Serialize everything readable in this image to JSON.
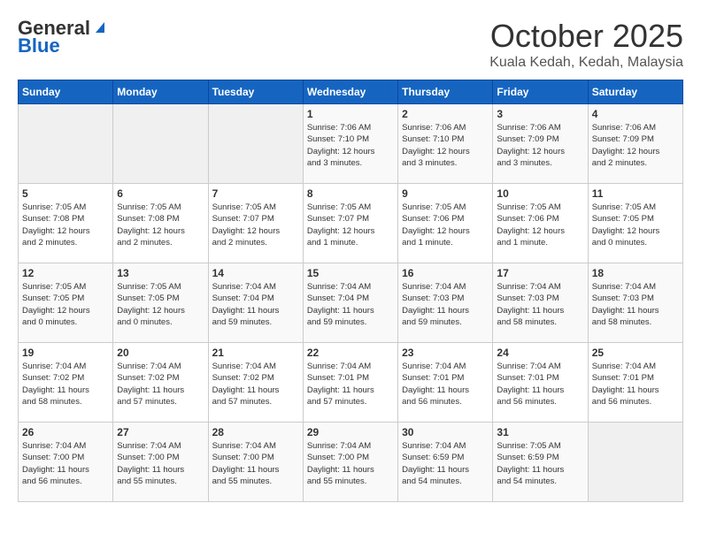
{
  "header": {
    "logo_general": "General",
    "logo_blue": "Blue",
    "month_title": "October 2025",
    "location": "Kuala Kedah, Kedah, Malaysia"
  },
  "days_of_week": [
    "Sunday",
    "Monday",
    "Tuesday",
    "Wednesday",
    "Thursday",
    "Friday",
    "Saturday"
  ],
  "weeks": [
    [
      {
        "num": "",
        "info": ""
      },
      {
        "num": "",
        "info": ""
      },
      {
        "num": "",
        "info": ""
      },
      {
        "num": "1",
        "info": "Sunrise: 7:06 AM\nSunset: 7:10 PM\nDaylight: 12 hours\nand 3 minutes."
      },
      {
        "num": "2",
        "info": "Sunrise: 7:06 AM\nSunset: 7:10 PM\nDaylight: 12 hours\nand 3 minutes."
      },
      {
        "num": "3",
        "info": "Sunrise: 7:06 AM\nSunset: 7:09 PM\nDaylight: 12 hours\nand 3 minutes."
      },
      {
        "num": "4",
        "info": "Sunrise: 7:06 AM\nSunset: 7:09 PM\nDaylight: 12 hours\nand 2 minutes."
      }
    ],
    [
      {
        "num": "5",
        "info": "Sunrise: 7:05 AM\nSunset: 7:08 PM\nDaylight: 12 hours\nand 2 minutes."
      },
      {
        "num": "6",
        "info": "Sunrise: 7:05 AM\nSunset: 7:08 PM\nDaylight: 12 hours\nand 2 minutes."
      },
      {
        "num": "7",
        "info": "Sunrise: 7:05 AM\nSunset: 7:07 PM\nDaylight: 12 hours\nand 2 minutes."
      },
      {
        "num": "8",
        "info": "Sunrise: 7:05 AM\nSunset: 7:07 PM\nDaylight: 12 hours\nand 1 minute."
      },
      {
        "num": "9",
        "info": "Sunrise: 7:05 AM\nSunset: 7:06 PM\nDaylight: 12 hours\nand 1 minute."
      },
      {
        "num": "10",
        "info": "Sunrise: 7:05 AM\nSunset: 7:06 PM\nDaylight: 12 hours\nand 1 minute."
      },
      {
        "num": "11",
        "info": "Sunrise: 7:05 AM\nSunset: 7:05 PM\nDaylight: 12 hours\nand 0 minutes."
      }
    ],
    [
      {
        "num": "12",
        "info": "Sunrise: 7:05 AM\nSunset: 7:05 PM\nDaylight: 12 hours\nand 0 minutes."
      },
      {
        "num": "13",
        "info": "Sunrise: 7:05 AM\nSunset: 7:05 PM\nDaylight: 12 hours\nand 0 minutes."
      },
      {
        "num": "14",
        "info": "Sunrise: 7:04 AM\nSunset: 7:04 PM\nDaylight: 11 hours\nand 59 minutes."
      },
      {
        "num": "15",
        "info": "Sunrise: 7:04 AM\nSunset: 7:04 PM\nDaylight: 11 hours\nand 59 minutes."
      },
      {
        "num": "16",
        "info": "Sunrise: 7:04 AM\nSunset: 7:03 PM\nDaylight: 11 hours\nand 59 minutes."
      },
      {
        "num": "17",
        "info": "Sunrise: 7:04 AM\nSunset: 7:03 PM\nDaylight: 11 hours\nand 58 minutes."
      },
      {
        "num": "18",
        "info": "Sunrise: 7:04 AM\nSunset: 7:03 PM\nDaylight: 11 hours\nand 58 minutes."
      }
    ],
    [
      {
        "num": "19",
        "info": "Sunrise: 7:04 AM\nSunset: 7:02 PM\nDaylight: 11 hours\nand 58 minutes."
      },
      {
        "num": "20",
        "info": "Sunrise: 7:04 AM\nSunset: 7:02 PM\nDaylight: 11 hours\nand 57 minutes."
      },
      {
        "num": "21",
        "info": "Sunrise: 7:04 AM\nSunset: 7:02 PM\nDaylight: 11 hours\nand 57 minutes."
      },
      {
        "num": "22",
        "info": "Sunrise: 7:04 AM\nSunset: 7:01 PM\nDaylight: 11 hours\nand 57 minutes."
      },
      {
        "num": "23",
        "info": "Sunrise: 7:04 AM\nSunset: 7:01 PM\nDaylight: 11 hours\nand 56 minutes."
      },
      {
        "num": "24",
        "info": "Sunrise: 7:04 AM\nSunset: 7:01 PM\nDaylight: 11 hours\nand 56 minutes."
      },
      {
        "num": "25",
        "info": "Sunrise: 7:04 AM\nSunset: 7:01 PM\nDaylight: 11 hours\nand 56 minutes."
      }
    ],
    [
      {
        "num": "26",
        "info": "Sunrise: 7:04 AM\nSunset: 7:00 PM\nDaylight: 11 hours\nand 56 minutes."
      },
      {
        "num": "27",
        "info": "Sunrise: 7:04 AM\nSunset: 7:00 PM\nDaylight: 11 hours\nand 55 minutes."
      },
      {
        "num": "28",
        "info": "Sunrise: 7:04 AM\nSunset: 7:00 PM\nDaylight: 11 hours\nand 55 minutes."
      },
      {
        "num": "29",
        "info": "Sunrise: 7:04 AM\nSunset: 7:00 PM\nDaylight: 11 hours\nand 55 minutes."
      },
      {
        "num": "30",
        "info": "Sunrise: 7:04 AM\nSunset: 6:59 PM\nDaylight: 11 hours\nand 54 minutes."
      },
      {
        "num": "31",
        "info": "Sunrise: 7:05 AM\nSunset: 6:59 PM\nDaylight: 11 hours\nand 54 minutes."
      },
      {
        "num": "",
        "info": ""
      }
    ]
  ]
}
